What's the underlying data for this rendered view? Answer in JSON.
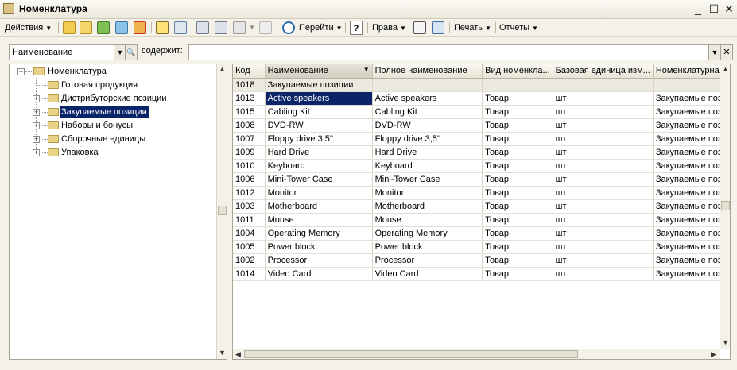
{
  "window": {
    "title": "Номенклатура",
    "minimize": "_",
    "maximize": "☐",
    "close": "✕"
  },
  "toolbar": {
    "actions_label": "Действия",
    "goto_label": "Перейти",
    "help_label": "?",
    "rights_label": "Права",
    "print_label": "Печать",
    "reports_label": "Отчеты"
  },
  "filter": {
    "field_value": "Наименование",
    "contains_label": "содержит:",
    "search_value": ""
  },
  "tree": {
    "root": "Номенклатура",
    "items": [
      {
        "label": "Готовая продукция",
        "expandable": false
      },
      {
        "label": "Дистрибуторские  позиции",
        "expandable": true
      },
      {
        "label": "Закупаемые позиции",
        "expandable": true,
        "selected": true
      },
      {
        "label": "Наборы и бонусы",
        "expandable": true
      },
      {
        "label": "Сборочные единицы",
        "expandable": true
      },
      {
        "label": "Упаковка",
        "expandable": true
      }
    ]
  },
  "grid": {
    "columns": [
      "Код",
      "Наименование",
      "Полное наименование",
      "Вид номенкла...",
      "Базовая единица изм...",
      "Номенклатурная"
    ],
    "group_row": {
      "code": "1018",
      "name": "Закупаемые позиции"
    },
    "rows": [
      {
        "code": "1013",
        "name": "Active speakers",
        "full": "Active speakers",
        "kind": "Товар",
        "unit": "шт",
        "group": "Закупаемые пози"
      },
      {
        "code": "1015",
        "name": "Cabling Kit",
        "full": "Cabling Kit",
        "kind": "Товар",
        "unit": "шт",
        "group": "Закупаемые пози"
      },
      {
        "code": "1008",
        "name": "DVD-RW",
        "full": "DVD-RW",
        "kind": "Товар",
        "unit": "шт",
        "group": "Закупаемые пози"
      },
      {
        "code": "1007",
        "name": "Floppy drive 3,5''",
        "full": "Floppy drive 3,5''",
        "kind": "Товар",
        "unit": "шт",
        "group": "Закупаемые пози"
      },
      {
        "code": "1009",
        "name": "Hard Drive",
        "full": "Hard Drive",
        "kind": "Товар",
        "unit": "шт",
        "group": "Закупаемые пози"
      },
      {
        "code": "1010",
        "name": "Keyboard",
        "full": "Keyboard",
        "kind": "Товар",
        "unit": "шт",
        "group": "Закупаемые пози"
      },
      {
        "code": "1006",
        "name": "Mini-Tower Case",
        "full": "Mini-Tower Case",
        "kind": "Товар",
        "unit": "шт",
        "group": "Закупаемые пози"
      },
      {
        "code": "1012",
        "name": "Monitor",
        "full": "Monitor",
        "kind": "Товар",
        "unit": "шт",
        "group": "Закупаемые пози"
      },
      {
        "code": "1003",
        "name": "Motherboard",
        "full": "Motherboard",
        "kind": "Товар",
        "unit": "шт",
        "group": "Закупаемые пози"
      },
      {
        "code": "1011",
        "name": "Mouse",
        "full": "Mouse",
        "kind": "Товар",
        "unit": "шт",
        "group": "Закупаемые пози"
      },
      {
        "code": "1004",
        "name": "Operating Memory",
        "full": "Operating Memory",
        "kind": "Товар",
        "unit": "шт",
        "group": "Закупаемые пози"
      },
      {
        "code": "1005",
        "name": "Power block",
        "full": "Power block",
        "kind": "Товар",
        "unit": "шт",
        "group": "Закупаемые пози"
      },
      {
        "code": "1002",
        "name": "Processor",
        "full": "Processor",
        "kind": "Товар",
        "unit": "шт",
        "group": "Закупаемые пози"
      },
      {
        "code": "1014",
        "name": "Video Card",
        "full": "Video Card",
        "kind": "Товар",
        "unit": "шт",
        "group": "Закупаемые пози"
      }
    ]
  },
  "colors": {
    "selection": "#0a246a",
    "window_bg": "#f3f1e8",
    "group_row_bg": "#ece9e0"
  }
}
